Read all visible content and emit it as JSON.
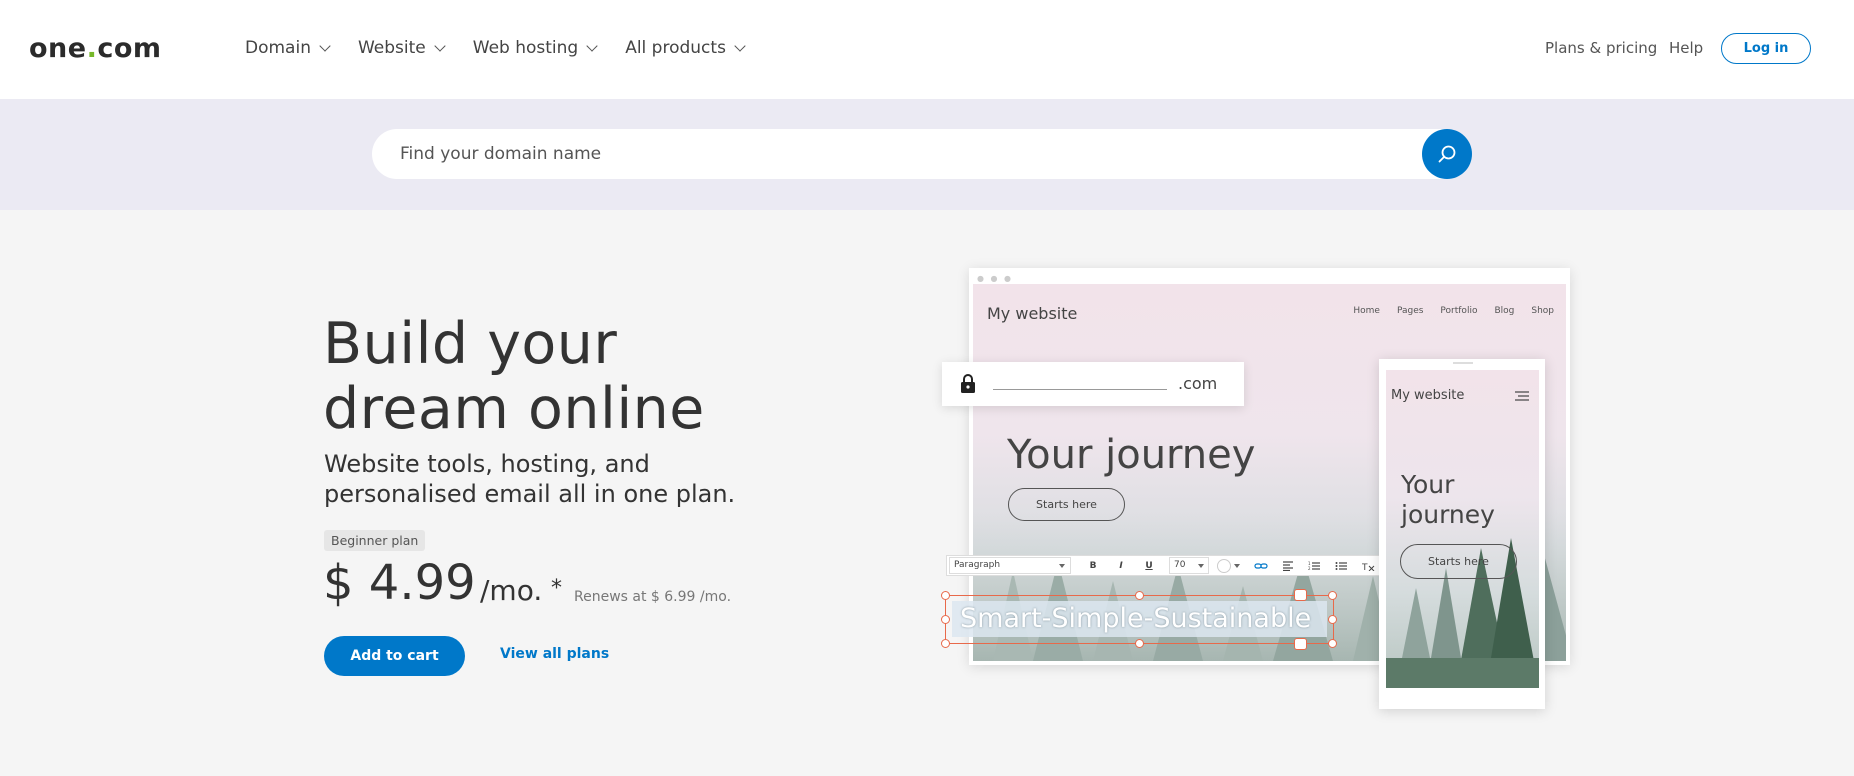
{
  "header": {
    "logo_text": "one",
    "logo_dot": ".",
    "logo_suffix": "com",
    "nav": [
      {
        "label": "Domain"
      },
      {
        "label": "Website"
      },
      {
        "label": "Web hosting"
      },
      {
        "label": "All products"
      }
    ],
    "plans_pricing": "Plans & pricing",
    "help": "Help",
    "login": "Log in"
  },
  "search": {
    "placeholder": "Find your domain name",
    "icon": "search-icon"
  },
  "hero": {
    "title_line1": "Build your",
    "title_line2": "dream online",
    "subtitle": "Website tools, hosting, and personalised email all in one plan.",
    "plan_badge": "Beginner plan",
    "price": "$ 4.99",
    "per_month": "/mo.",
    "asterisk": "*",
    "renews": "Renews at $ 6.99 /mo.",
    "add_to_cart": "Add to cart",
    "view_all_plans": "View all plans"
  },
  "illustration": {
    "site_title": "My website",
    "site_menu": [
      "Home",
      "Pages",
      "Portfolio",
      "Blog",
      "Shop"
    ],
    "journey": "Your journey",
    "starts_here": "Starts here",
    "domain_tld": ".com",
    "toolbar": {
      "paragraph": "Paragraph",
      "bold": "B",
      "italic": "I",
      "underline": "U",
      "font_size": "70"
    },
    "editable_text": "Smart-Simple-Sustainable",
    "phone_title": "My website",
    "phone_journey_line1": "Your",
    "phone_journey_line2": "journey",
    "phone_starts_here": "Starts here"
  },
  "colors": {
    "brand_blue": "#0078c9",
    "logo_green": "#76b82a",
    "search_band": "#ebeaf3",
    "selection_orange": "#e8694a"
  }
}
